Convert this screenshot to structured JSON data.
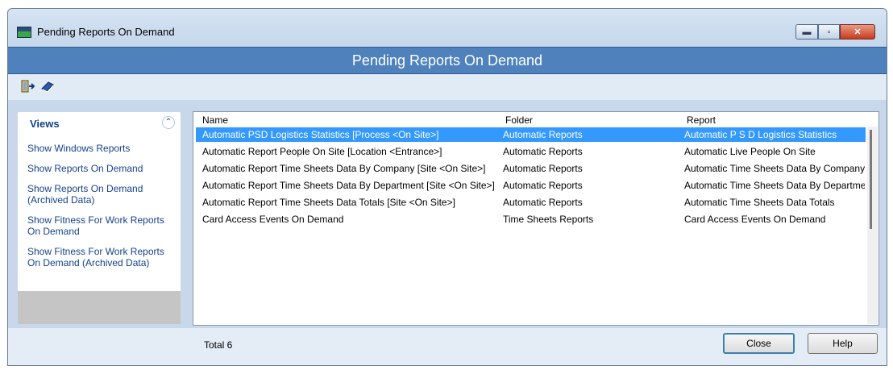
{
  "window": {
    "title": "Pending Reports On Demand",
    "controls": {
      "minimize": "▬",
      "maximize": "▫",
      "close": "✕"
    }
  },
  "header": {
    "title": "Pending Reports On Demand"
  },
  "toolbar": {
    "exit_icon": "exit-icon",
    "help_icon": "help-book-icon"
  },
  "sidebar": {
    "title": "Views",
    "collapse_icon": "chevron-up-icon",
    "items": [
      {
        "label": "Show Windows Reports"
      },
      {
        "label": "Show Reports On Demand"
      },
      {
        "label": "Show Reports On Demand (Archived Data)"
      },
      {
        "label": "Show Fitness For Work Reports On Demand"
      },
      {
        "label": "Show Fitness For Work Reports On Demand (Archived Data)"
      }
    ]
  },
  "list": {
    "columns": {
      "name": "Name",
      "folder": "Folder",
      "report": "Report"
    },
    "rows": [
      {
        "name": "Automatic PSD Logistics Statistics [Process <On Site>]",
        "folder": "Automatic Reports",
        "report": "Automatic P S D Logistics Statistics"
      },
      {
        "name": "Automatic Report People On Site [Location <Entrance>]",
        "folder": "Automatic Reports",
        "report": "Automatic Live People On Site"
      },
      {
        "name": "Automatic Report Time Sheets Data By Company [Site <On Site>]",
        "folder": "Automatic Reports",
        "report": "Automatic Time Sheets Data By Company"
      },
      {
        "name": "Automatic Report Time Sheets Data By Department [Site <On Site>]",
        "folder": "Automatic Reports",
        "report": "Automatic Time Sheets Data By Department"
      },
      {
        "name": "Automatic Report Time Sheets Data Totals [Site <On Site>]",
        "folder": "Automatic Reports",
        "report": "Automatic Time Sheets Data Totals"
      },
      {
        "name": "Card Access Events On Demand",
        "folder": "Time Sheets Reports",
        "report": "Card Access Events On Demand"
      }
    ],
    "selected_index": 0
  },
  "status": {
    "total": "Total 6"
  },
  "buttons": {
    "close": "Close",
    "help": "Help"
  },
  "colors": {
    "header_band": "#4f81bd",
    "selection": "#3399ff",
    "link_text": "#15428b"
  }
}
